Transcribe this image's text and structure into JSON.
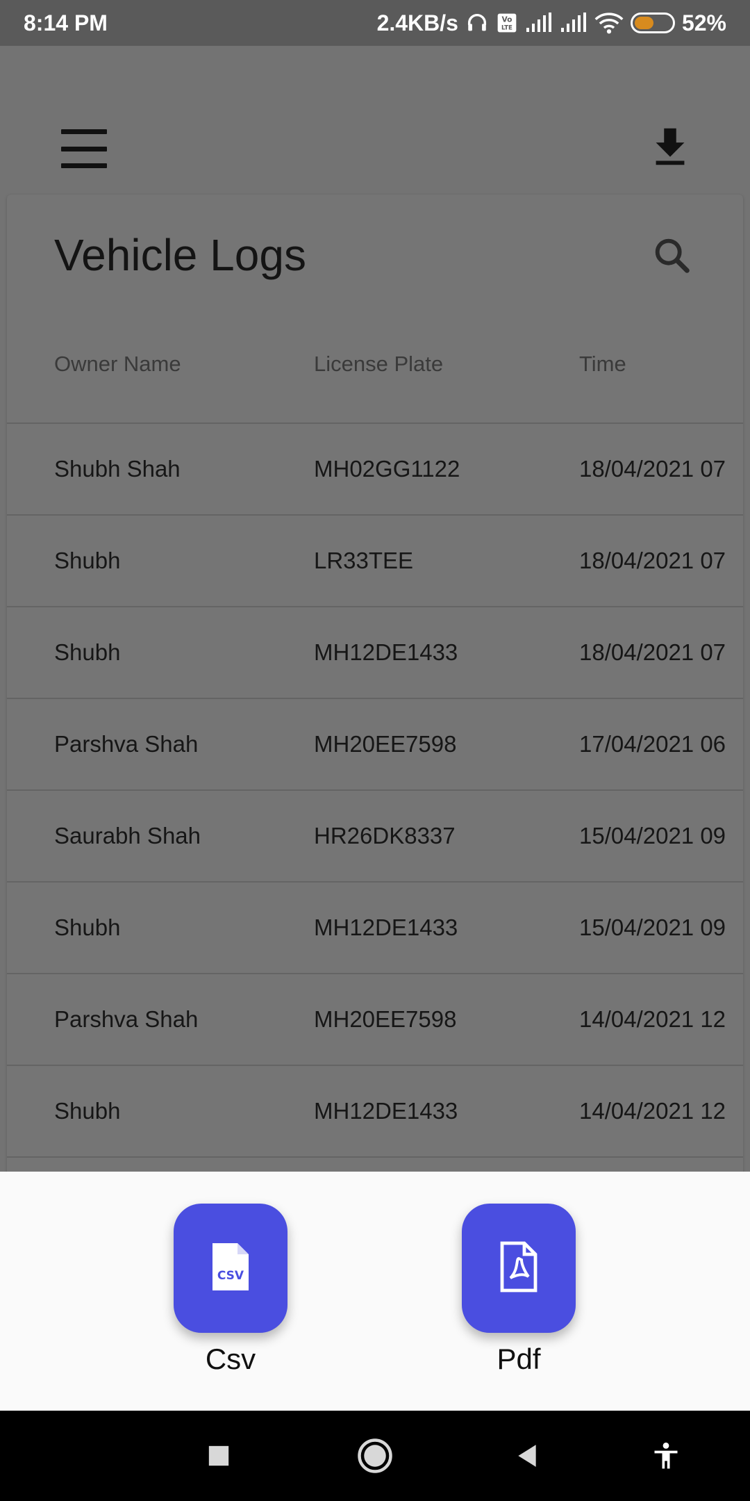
{
  "status_bar": {
    "time": "8:14 PM",
    "network_speed": "2.4KB/s",
    "volte": "Vo LTE",
    "battery_percent": "52%",
    "battery_level": 0.52,
    "battery_color": "#d88b1e"
  },
  "app_bar": {
    "menu_icon": "hamburger-menu-icon",
    "download_icon": "download-icon"
  },
  "card": {
    "title": "Vehicle Logs",
    "search_icon": "search-icon",
    "columns": [
      "Owner Name",
      "License Plate",
      "Time"
    ],
    "rows": [
      {
        "owner": "Shubh Shah",
        "plate": "MH02GG1122",
        "time": "18/04/2021 07"
      },
      {
        "owner": "Shubh",
        "plate": "LR33TEE",
        "time": "18/04/2021 07"
      },
      {
        "owner": "Shubh",
        "plate": "MH12DE1433",
        "time": "18/04/2021 07"
      },
      {
        "owner": "Parshva Shah",
        "plate": "MH20EE7598",
        "time": "17/04/2021 06"
      },
      {
        "owner": "Saurabh Shah",
        "plate": "HR26DK8337",
        "time": "15/04/2021 09"
      },
      {
        "owner": "Shubh",
        "plate": "MH12DE1433",
        "time": "15/04/2021 09"
      },
      {
        "owner": "Parshva Shah",
        "plate": "MH20EE7598",
        "time": "14/04/2021 12"
      },
      {
        "owner": "Shubh",
        "plate": "MH12DE1433",
        "time": "14/04/2021 12"
      }
    ]
  },
  "sheet": {
    "options": [
      {
        "label": "Csv",
        "icon": "csv-file-icon",
        "icon_text": "CSV"
      },
      {
        "label": "Pdf",
        "icon": "pdf-file-icon"
      }
    ],
    "accent": "#4a4ee0"
  },
  "nav_bar": {
    "items": [
      "recents-square-icon",
      "home-circle-icon",
      "back-triangle-icon",
      "accessibility-icon"
    ]
  }
}
